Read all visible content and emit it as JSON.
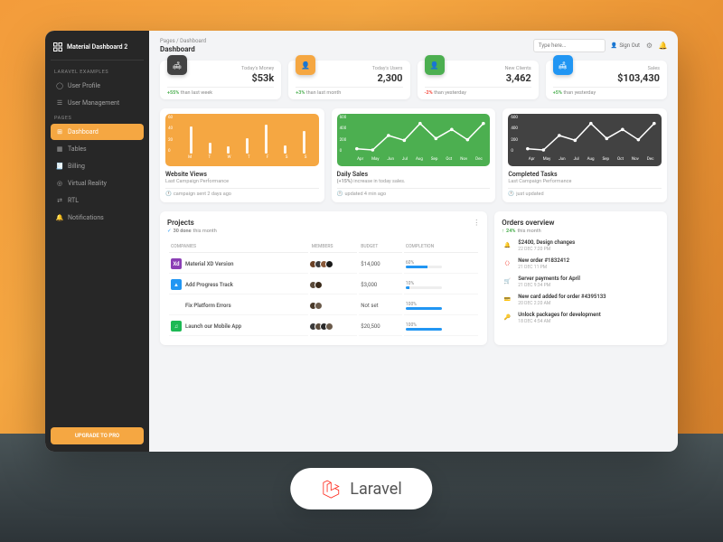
{
  "brand": "Material Dashboard 2",
  "sidebar": {
    "section1_label": "LARAVEL EXAMPLES",
    "section2_label": "PAGES",
    "items1": [
      {
        "label": "User Profile",
        "icon": "user-icon"
      },
      {
        "label": "User Management",
        "icon": "list-icon"
      }
    ],
    "items2": [
      {
        "label": "Dashboard",
        "icon": "dashboard-icon",
        "active": true
      },
      {
        "label": "Tables",
        "icon": "table-icon"
      },
      {
        "label": "Billing",
        "icon": "receipt-icon"
      },
      {
        "label": "Virtual Reality",
        "icon": "vr-icon"
      },
      {
        "label": "RTL",
        "icon": "rtl-icon"
      },
      {
        "label": "Notifications",
        "icon": "bell-icon"
      }
    ],
    "upgrade": "UPGRADE TO PRO"
  },
  "topbar": {
    "crumb_root": "Pages",
    "crumb_current": "Dashboard",
    "title": "Dashboard",
    "search_placeholder": "Type here...",
    "signout": "Sign Out"
  },
  "stats": [
    {
      "label": "Today's Money",
      "value": "$53k",
      "delta": "+55%",
      "delta_sign": "pos",
      "delta_text": "than last week",
      "color": "#424242",
      "icon": "weekend-icon"
    },
    {
      "label": "Today's Users",
      "value": "2,300",
      "delta": "+3%",
      "delta_sign": "pos",
      "delta_text": "than last month",
      "color": "#f5a742",
      "icon": "person-icon"
    },
    {
      "label": "New Clients",
      "value": "3,462",
      "delta": "-2%",
      "delta_sign": "neg",
      "delta_text": "than yesterday",
      "color": "#4caf50",
      "icon": "person-icon"
    },
    {
      "label": "Sales",
      "value": "$103,430",
      "delta": "+5%",
      "delta_sign": "pos",
      "delta_text": "than yesterday",
      "color": "#2196f3",
      "icon": "weekend-icon"
    }
  ],
  "chart_data": [
    {
      "type": "bar",
      "title": "Website Views",
      "subtitle": "Last Campaign Performance",
      "footer": "campaign sent 2 days ago",
      "bg": "#f5a742",
      "categories": [
        "M",
        "T",
        "W",
        "T",
        "F",
        "S",
        "S"
      ],
      "values": [
        45,
        18,
        12,
        25,
        48,
        14,
        38
      ],
      "ylim": [
        0,
        60
      ],
      "yticks": [
        60,
        40,
        20,
        0
      ]
    },
    {
      "type": "line",
      "title": "Daily Sales",
      "subtitle_prefix": "(+15%)",
      "subtitle": "increase in today sales.",
      "footer": "updated 4 min ago",
      "bg": "#4caf50",
      "categories": [
        "Apr",
        "May",
        "Jun",
        "Jul",
        "Aug",
        "Sep",
        "Oct",
        "Nov",
        "Dec"
      ],
      "values": [
        80,
        60,
        300,
        220,
        500,
        250,
        400,
        230,
        500
      ],
      "ylim": [
        0,
        600
      ],
      "yticks": [
        600,
        400,
        200,
        0
      ]
    },
    {
      "type": "line",
      "title": "Completed Tasks",
      "subtitle": "Last Campaign Performance",
      "footer": "just updated",
      "bg": "#424242",
      "categories": [
        "Apr",
        "May",
        "Jun",
        "Jul",
        "Aug",
        "Sep",
        "Oct",
        "Nov",
        "Dec"
      ],
      "values": [
        80,
        60,
        300,
        220,
        500,
        250,
        400,
        230,
        500
      ],
      "ylim": [
        0,
        600
      ],
      "yticks": [
        600,
        400,
        200,
        0
      ]
    }
  ],
  "projects": {
    "title": "Projects",
    "subtitle_prefix": "30 done",
    "subtitle": "this month",
    "columns": [
      "COMPANIES",
      "MEMBERS",
      "BUDGET",
      "COMPLETION"
    ],
    "rows": [
      {
        "name": "Material XD Version",
        "icon_bg": "#8b3fb5",
        "icon_txt": "Xd",
        "members": [
          "#6b4226",
          "#3a3a3a",
          "#8a5a3a",
          "#1a1a1a"
        ],
        "budget": "$14,000",
        "completion": 60
      },
      {
        "name": "Add Progress Track",
        "icon_bg": "#2196f3",
        "icon_txt": "▲",
        "members": [
          "#5a4a3a",
          "#3a2a1a"
        ],
        "budget": "$3,000",
        "completion": 10
      },
      {
        "name": "Fix Platform Errors",
        "icon_bg": "#fff",
        "icon_txt": "⊞",
        "members": [
          "#4a3a2a",
          "#6a5a4a"
        ],
        "budget": "Not set",
        "completion": 100
      },
      {
        "name": "Launch our Mobile App",
        "icon_bg": "#1db954",
        "icon_txt": "♫",
        "members": [
          "#3a3a3a",
          "#5a4a3a",
          "#2a2a2a",
          "#6a5a4a"
        ],
        "budget": "$20,500",
        "completion": 100
      }
    ]
  },
  "orders": {
    "title": "Orders overview",
    "subtitle_prefix": "24%",
    "subtitle": "this month",
    "items": [
      {
        "text": "$2400, Design changes",
        "date": "22 DEC 7:20 PM",
        "color": "#4caf50",
        "icon": "bell-icon"
      },
      {
        "text": "New order #1832412",
        "date": "21 DEC 11 PM",
        "color": "#f44336",
        "icon": "code-icon"
      },
      {
        "text": "Server payments for April",
        "date": "21 DEC 9:34 PM",
        "color": "#2196f3",
        "icon": "cart-icon"
      },
      {
        "text": "New card added for order #4395133",
        "date": "20 DEC 2:20 AM",
        "color": "#ff9800",
        "icon": "card-icon"
      },
      {
        "text": "Unlock packages for development",
        "date": "18 DEC 4:54 AM",
        "color": "#e91e63",
        "icon": "key-icon"
      }
    ]
  },
  "pill": "Laravel"
}
